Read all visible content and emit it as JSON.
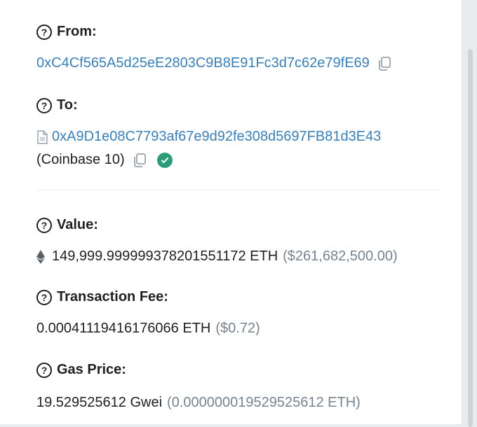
{
  "from": {
    "label": "From:",
    "address": "0xC4Cf565A5d25eE2803C9B8E91Fc3d7c62e79fE69"
  },
  "to": {
    "label": "To:",
    "address": "0xA9D1e08C7793af67e9d92fe308d5697FB81d3E43",
    "name_tag": "(Coinbase 10)"
  },
  "value": {
    "label": "Value:",
    "amount": "149,999.999999378201551172 ETH",
    "usd": "($261,682,500.00)"
  },
  "fee": {
    "label": "Transaction Fee:",
    "amount": "0.00041119416176066 ETH",
    "usd": "($0.72)"
  },
  "gas": {
    "label": "Gas Price:",
    "amount": "19.529525612 Gwei",
    "eth": "(0.000000019529525612 ETH)"
  },
  "icons": {
    "help": "?"
  },
  "colors": {
    "link": "#3a7fb5",
    "verified": "#2b9c77",
    "muted": "#77838f"
  }
}
